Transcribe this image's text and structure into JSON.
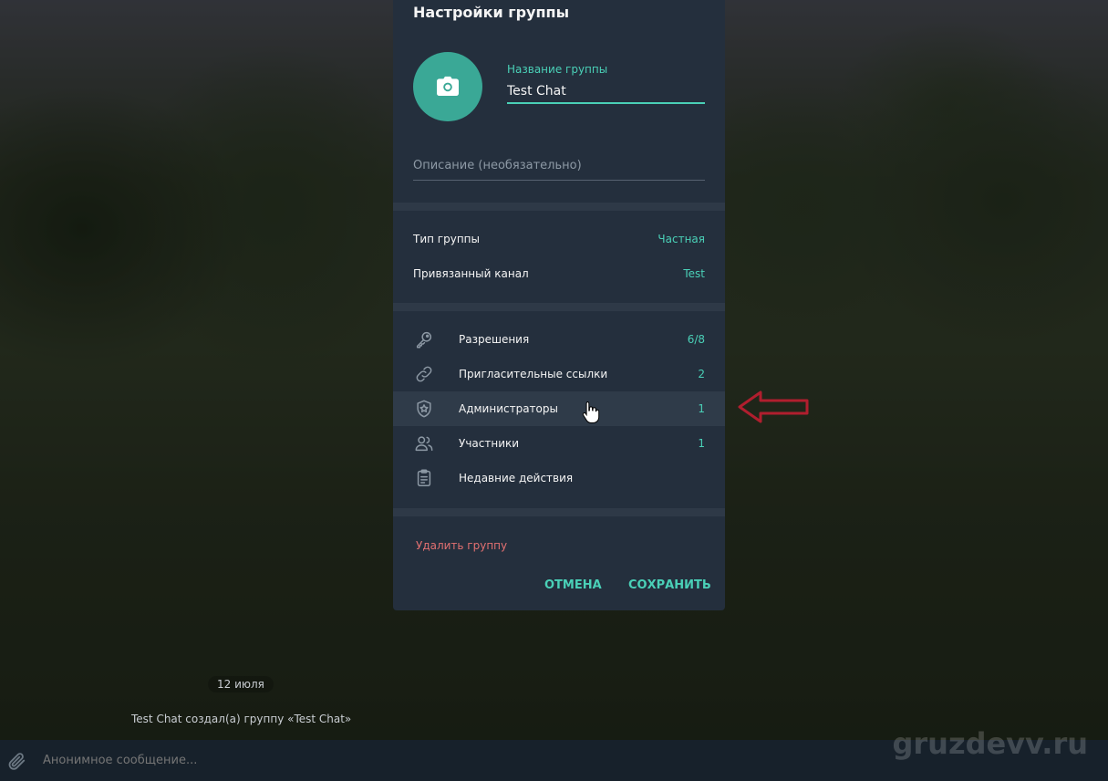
{
  "chat": {
    "date": "12 июля",
    "service_message": "Test Chat создал(а) группу «Test Chat»",
    "composer_placeholder": "Анонимное сообщение...",
    "watermark": "gruzdevv.ru"
  },
  "dialog": {
    "title": "Настройки группы",
    "name_label": "Название группы",
    "name_value": "Test Chat",
    "description_placeholder": "Описание (необязательно)",
    "info_rows": [
      {
        "label": "Тип группы",
        "value": "Частная"
      },
      {
        "label": "Привязанный канал",
        "value": "Test"
      }
    ],
    "menu_rows": [
      {
        "label": "Разрешения",
        "value": "6/8",
        "icon": "key-icon"
      },
      {
        "label": "Пригласительные ссылки",
        "value": "2",
        "icon": "link-icon"
      },
      {
        "label": "Администраторы",
        "value": "1",
        "icon": "admin-shield-icon"
      },
      {
        "label": "Участники",
        "value": "1",
        "icon": "members-icon"
      },
      {
        "label": "Недавние действия",
        "value": "",
        "icon": "clipboard-icon"
      }
    ],
    "delete_label": "Удалить группу",
    "cancel_label": "ОТМЕНА",
    "save_label": "СОХРАНИТЬ"
  },
  "colors": {
    "accent": "#4ad0b7",
    "avatar": "#3aa896",
    "danger": "#e27071",
    "panel": "#242f3d",
    "annotation_arrow": "#b01e2e"
  }
}
